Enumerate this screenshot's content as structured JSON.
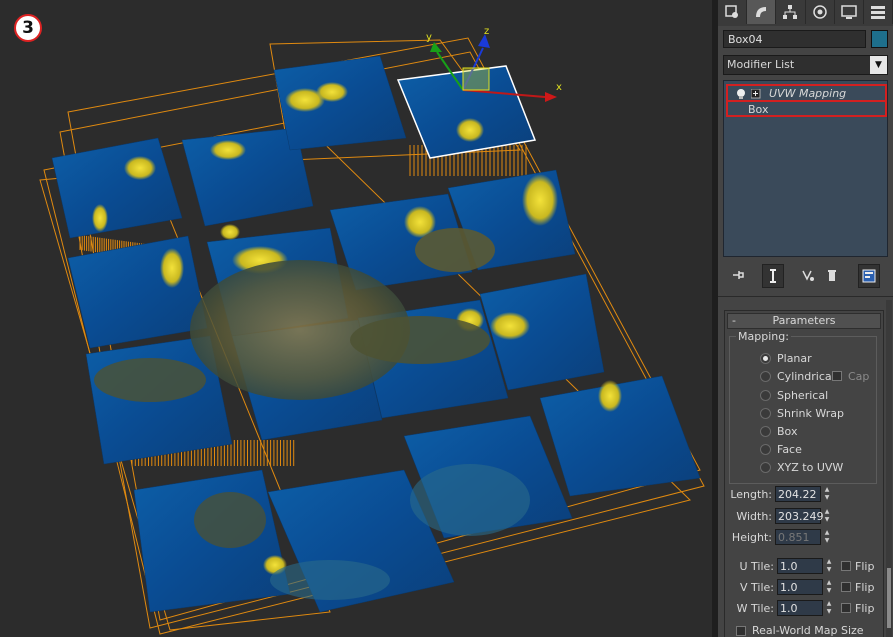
{
  "step_badge": "3",
  "viewport": {
    "gizmo": {
      "x_label": "x",
      "y_label": "y",
      "z_label": "z"
    }
  },
  "panel": {
    "tabs": [
      "create-icon",
      "modify-icon",
      "hierarchy-icon",
      "motion-icon",
      "display-icon",
      "utilities-icon"
    ],
    "object_name": "Box04",
    "object_color": "#1e6f8c",
    "modifier_list": "Modifier List",
    "stack": {
      "uvw_mapping": "UVW Mapping",
      "box": "Box"
    },
    "rollout_title": "Parameters",
    "rollout_toggle": "-",
    "mapping": {
      "title": "Mapping:",
      "options": {
        "planar": "Planar",
        "cylindrical": "Cylindrical",
        "cap": "Cap",
        "spherical": "Spherical",
        "shrink_wrap": "Shrink Wrap",
        "box": "Box",
        "face": "Face",
        "xyz_to_uvw": "XYZ to UVW"
      },
      "selected": "Planar"
    },
    "dims": {
      "length_label": "Length:",
      "length": "204.22",
      "width_label": "Width:",
      "width": "203.249",
      "height_label": "Height:",
      "height": "0.851"
    },
    "tiles": {
      "u_label": "U Tile:",
      "u": "1.0",
      "v_label": "V Tile:",
      "v": "1.0",
      "w_label": "W Tile:",
      "w": "1.0",
      "flip": "Flip"
    },
    "real_world": "Real-World Map Size"
  }
}
